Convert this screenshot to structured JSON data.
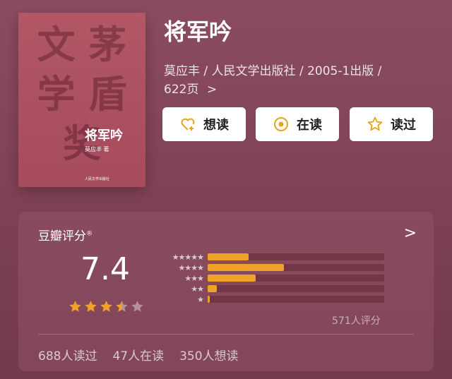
{
  "book": {
    "title": "将军吟",
    "meta_line1": "莫应丰 / 人民文学出版社 / 2005-1出版 /",
    "meta_line2": "622页",
    "meta_chev": ">"
  },
  "cover": {
    "bg_text_line1": "文 茅",
    "bg_text_line2": "学 盾",
    "bg_text_line3": "奖",
    "title": "将军吟",
    "author": "莫应丰 著",
    "publisher": "人民文学出版社"
  },
  "actions": {
    "want_label": "想读",
    "reading_label": "在读",
    "read_label": "读过"
  },
  "rating": {
    "heading": "豆瓣评分",
    "heading_mark": "®",
    "chevron": ">",
    "score": "7.4",
    "stars_filled": 3.5,
    "stars_total": 5,
    "distribution": [
      {
        "stars": "★★★★★",
        "fraction": 0.23
      },
      {
        "stars": "★★★★",
        "fraction": 0.43
      },
      {
        "stars": "★★★",
        "fraction": 0.27
      },
      {
        "stars": "★★",
        "fraction": 0.05
      },
      {
        "stars": "★",
        "fraction": 0.01
      }
    ],
    "count": "571人评分"
  },
  "stats": {
    "read": "688人读过",
    "reading": "47人在读",
    "want": "350人想读"
  },
  "colors": {
    "accent": "#f0a128",
    "background": "#7e4154"
  }
}
